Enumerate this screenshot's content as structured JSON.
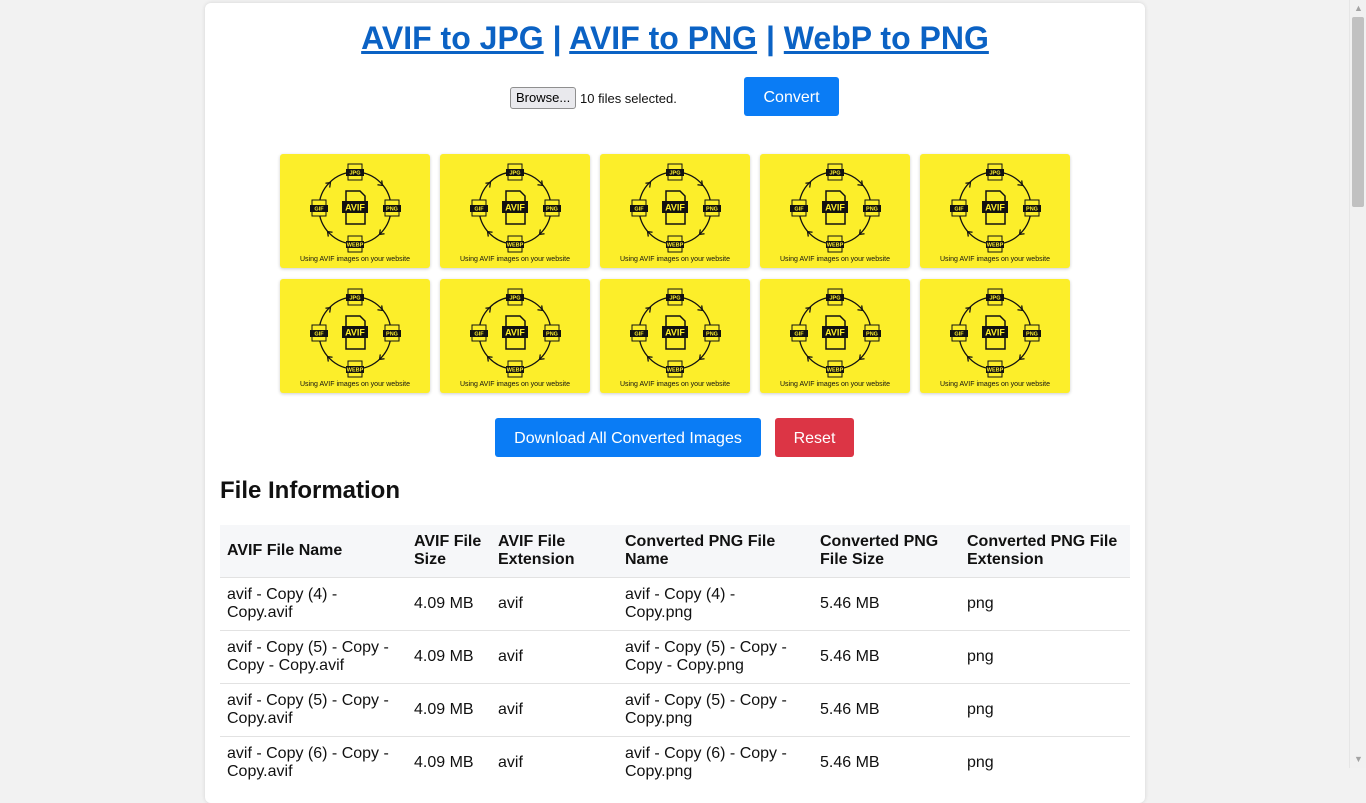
{
  "header": {
    "links": [
      "AVIF to JPG",
      "AVIF to PNG",
      "WebP to PNG"
    ],
    "separator": "|"
  },
  "upload": {
    "browse_label": "Browse...",
    "files_selected": "10 files selected.",
    "convert_label": "Convert"
  },
  "thumbnail": {
    "center_label": "AVIF",
    "formats": [
      "JPG",
      "PNG",
      "WEBP",
      "GIF"
    ],
    "caption": "Using AVIF images on your website",
    "count": 10,
    "colors": {
      "background": "#fcee2a",
      "ink": "#111111"
    }
  },
  "actions": {
    "download_label": "Download All Converted Images",
    "reset_label": "Reset"
  },
  "colors": {
    "primary": "#0a7cf5",
    "danger": "#dc3545",
    "link": "#0b62c4"
  },
  "file_info": {
    "title": "File Information",
    "headers": [
      "AVIF File Name",
      "AVIF File Size",
      "AVIF File Extension",
      "Converted PNG File Name",
      "Converted PNG File Size",
      "Converted PNG File Extension"
    ],
    "rows": [
      [
        "avif - Copy (4) - Copy.avif",
        "4.09 MB",
        "avif",
        "avif - Copy (4) - Copy.png",
        "5.46 MB",
        "png"
      ],
      [
        "avif - Copy (5) - Copy - Copy - Copy.avif",
        "4.09 MB",
        "avif",
        "avif - Copy (5) - Copy - Copy - Copy.png",
        "5.46 MB",
        "png"
      ],
      [
        "avif - Copy (5) - Copy - Copy.avif",
        "4.09 MB",
        "avif",
        "avif - Copy (5) - Copy - Copy.png",
        "5.46 MB",
        "png"
      ],
      [
        "avif - Copy (6) - Copy - Copy.avif",
        "4.09 MB",
        "avif",
        "avif - Copy (6) - Copy - Copy.png",
        "5.46 MB",
        "png"
      ]
    ]
  }
}
